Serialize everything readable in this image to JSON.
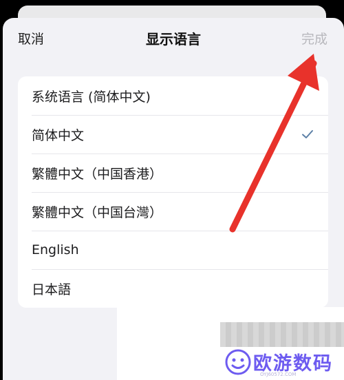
{
  "nav": {
    "cancel_label": "取消",
    "title": "显示语言",
    "done_label": "完成"
  },
  "languages": [
    {
      "label": "系统语言 (简体中文)",
      "selected": false
    },
    {
      "label": "简体中文",
      "selected": true
    },
    {
      "label": "繁體中文（中国香港）",
      "selected": false
    },
    {
      "label": "繁體中文（中国台灣）",
      "selected": false
    },
    {
      "label": "English",
      "selected": false
    },
    {
      "label": "日本語",
      "selected": false
    }
  ],
  "watermark": {
    "text": "欧游数码",
    "url": "OYJ60572.COM"
  },
  "colors": {
    "check": "#5b7fa6",
    "arrow": "#e8322b",
    "watermark": "#6d5bf0"
  }
}
